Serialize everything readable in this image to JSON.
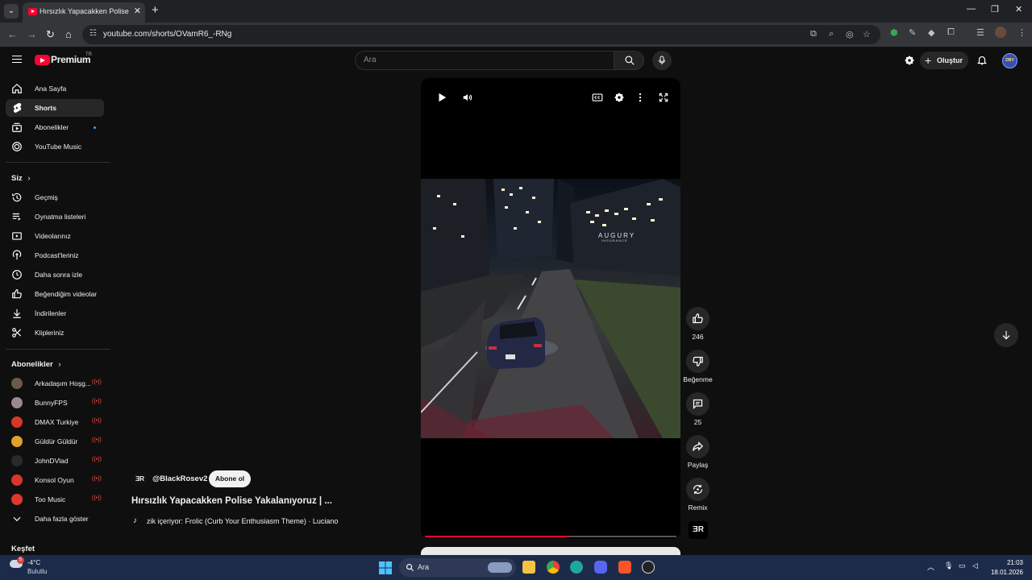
{
  "browser": {
    "tab_title": "Hırsızlık Yapacakken Polise Yaka",
    "url": "youtube.com/shorts/OVamR6_-RNg"
  },
  "header": {
    "logo_text": "Premium",
    "region": "TR",
    "search_placeholder": "Ara",
    "create_label": "Oluştur",
    "avatar_text": "DBY"
  },
  "sidebar": {
    "main": [
      {
        "label": "Ana Sayfa"
      },
      {
        "label": "Shorts"
      },
      {
        "label": "Abonelikler"
      },
      {
        "label": "YouTube Music"
      }
    ],
    "you_heading": "Siz",
    "you": [
      {
        "label": "Geçmiş"
      },
      {
        "label": "Oynatma listeleri"
      },
      {
        "label": "Videolarınız"
      },
      {
        "label": "Podcast'leriniz"
      },
      {
        "label": "Daha sonra izle"
      },
      {
        "label": "Beğendiğim videolar"
      },
      {
        "label": "İndirilenler"
      },
      {
        "label": "Klipleriniz"
      }
    ],
    "subs_heading": "Abonelikler",
    "subs": [
      {
        "label": "Arkadaşım Hoşg...",
        "color": "#6a5a4a"
      },
      {
        "label": "BunnyFPS",
        "color": "#9a8a8a"
      },
      {
        "label": "DMAX Turkiye",
        "color": "#d8362b"
      },
      {
        "label": "Güldür Güldür",
        "color": "#e0a02a"
      },
      {
        "label": "JohnDVlad",
        "color": "#2a2a2a"
      },
      {
        "label": "Konsol Oyun",
        "color": "#d8362b"
      },
      {
        "label": "Too Music",
        "color": "#e0372b"
      }
    ],
    "show_more": "Daha fazla göster",
    "explore_heading": "Keşfet"
  },
  "video": {
    "billboard": "AUGURY",
    "billboard_sub": "INSURANCE",
    "progress": 0.57
  },
  "actions": {
    "likes": "246",
    "dislike": "Beğenme",
    "comments": "25",
    "share": "Paylaş",
    "remix": "Remix",
    "channel_mark": "ƎR"
  },
  "info": {
    "channel_mark": "ƎR",
    "handle": "@BlackRosev2",
    "subscribe": "Abone ol",
    "title": "Hırsızlık Yapacakken Polise Yakalanıyoruz | ...",
    "music": "zik içeriyor: Frolic (Curb Your Enthusiasm Theme) · Luciano"
  },
  "taskbar": {
    "temp": "-4°C",
    "weather": "Bulutlu",
    "weather_badge": "5",
    "search": "Ara",
    "time": "21:03",
    "date": "18.01.2026"
  }
}
